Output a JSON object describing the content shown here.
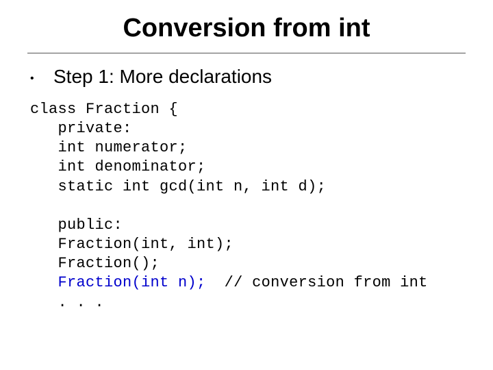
{
  "title": "Conversion from int",
  "subtitle": "Step 1:  More declarations",
  "code": {
    "line1": "class Fraction {",
    "line2": "   private:",
    "line3": "   int numerator;",
    "line4": "   int denominator;",
    "line5": "   static int gcd(int n, int d);",
    "blank": "",
    "line6": "   public:",
    "line7": "   Fraction(int, int);",
    "line8": "   Fraction();",
    "line9a": "   ",
    "line9b": "Fraction(int n);",
    "line9c": "  // conversion from int",
    "line10": "   . . ."
  }
}
